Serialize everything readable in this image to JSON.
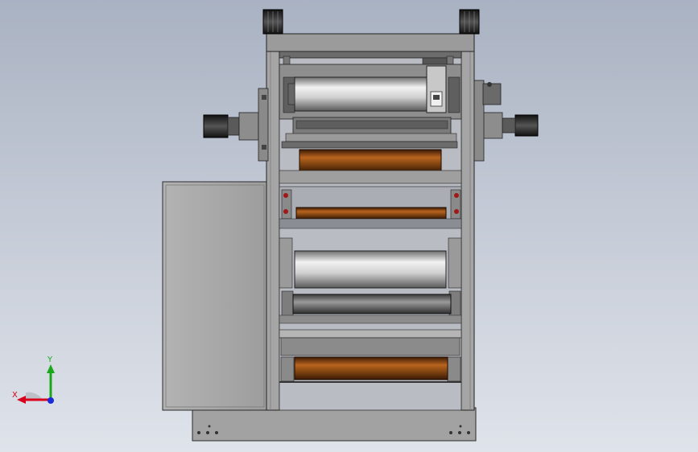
{
  "viewport": {
    "background_top": "#a9b2c2",
    "background_bottom": "#dfe3ea"
  },
  "model": {
    "frame_color": "#9a9a9a",
    "roller_copper": "#8a4a12",
    "roller_silver": "#d4d4d4",
    "cabinet_color": "#a8a8a8"
  },
  "triad": {
    "x_label": "X",
    "y_label": "Y",
    "x_color": "#d9001b",
    "y_color": "#1aa81a",
    "z_color": "#1a2bd9"
  }
}
